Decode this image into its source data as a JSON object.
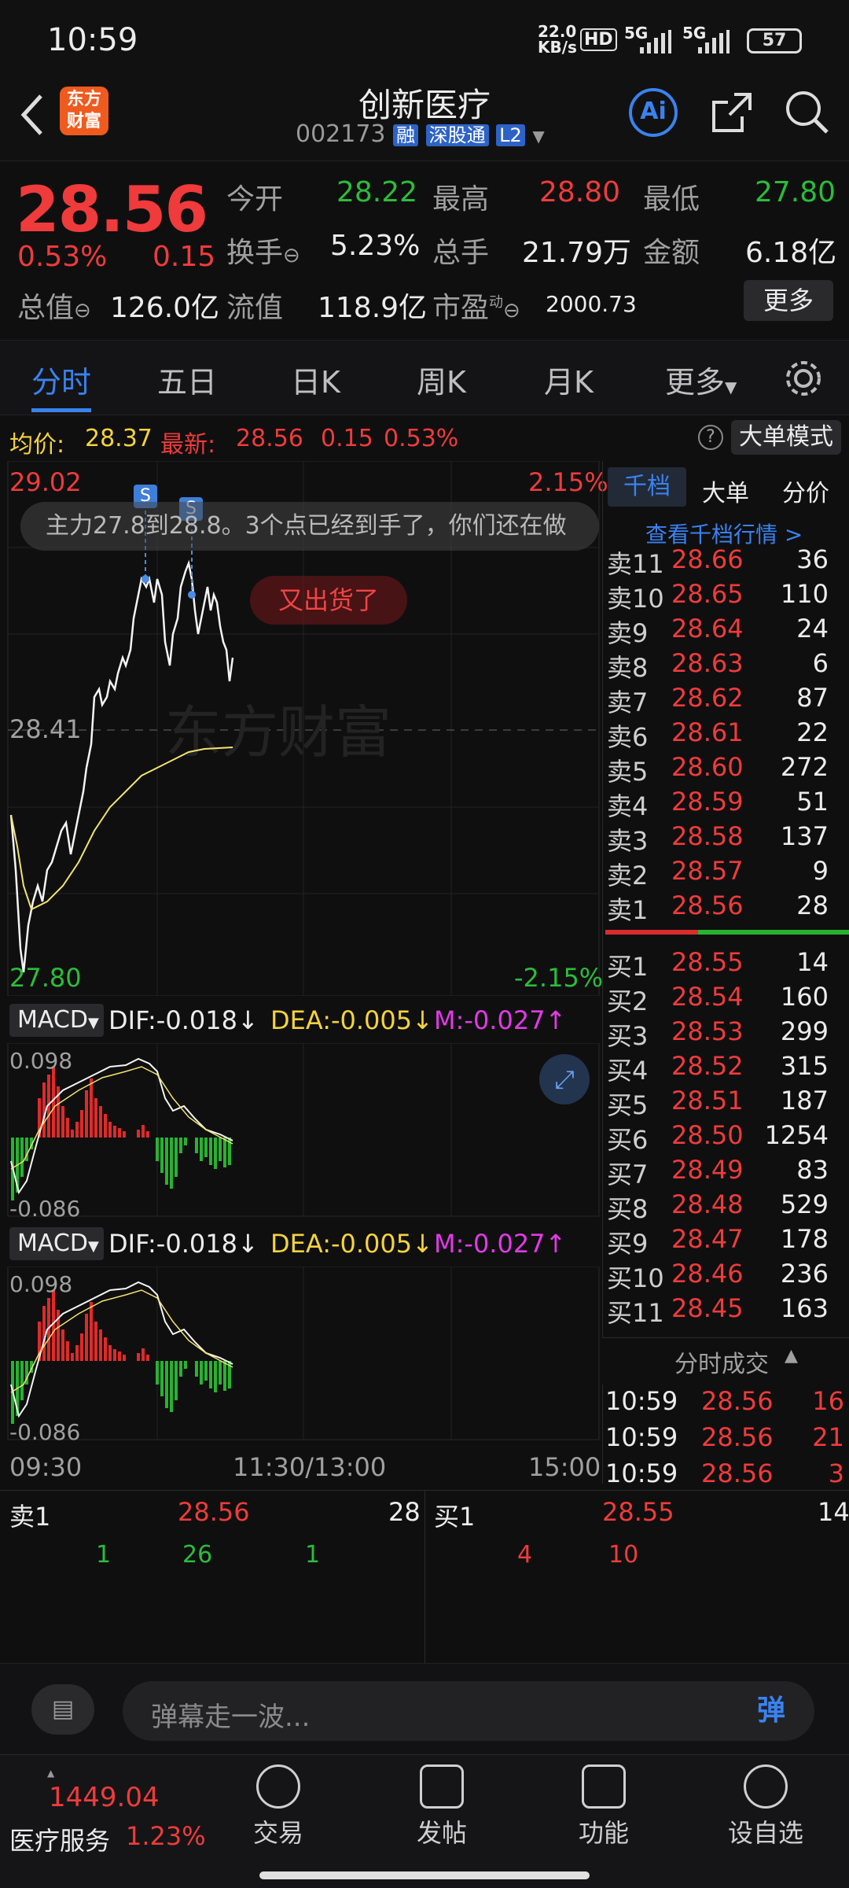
{
  "status": {
    "time": "10:59",
    "speed": "22.0",
    "speed_unit": "KB/s",
    "hd": "HD",
    "net1": "5G",
    "net2": "5G",
    "battery": "57"
  },
  "title": {
    "app_logo": "东方财富",
    "name": "创新医疗",
    "code": "002173",
    "tags": [
      "融",
      "深股通",
      "L2"
    ]
  },
  "quote": {
    "price": "28.56",
    "pct": "0.53%",
    "chg": "0.15",
    "open_lbl": "今开",
    "open": "28.22",
    "high_lbl": "最高",
    "high": "28.80",
    "low_lbl": "最低",
    "low": "27.80",
    "turn_lbl": "换手",
    "turn": "5.23%",
    "vol_lbl": "总手",
    "vol": "21.79万",
    "amt_lbl": "金额",
    "amt": "6.18亿",
    "mcap_lbl": "总值",
    "mcap": "126.0亿",
    "float_lbl": "流值",
    "float": "118.9亿",
    "pe_lbl": "市盈",
    "pe_sup": "动",
    "pe": "2000.73",
    "more": "更多"
  },
  "tabs": [
    "分时",
    "五日",
    "日K",
    "周K",
    "月K",
    "更多"
  ],
  "chart_header": {
    "avg_lbl": "均价:",
    "avg": "28.37",
    "last_lbl": "最新:",
    "last": "28.56",
    "chg": "0.15",
    "pct": "0.53%",
    "mode": "大单模式"
  },
  "chart": {
    "top_price": "29.02",
    "top_pct": "2.15%",
    "mid_price": "28.41",
    "bot_price": "27.80",
    "bot_pct": "-2.15%",
    "danmu": "主力27.8到28.8。3个点已经到手了，你们还在做",
    "bubble": "又出货了",
    "watermark": "东方财富",
    "s_mark": "S"
  },
  "macd1": {
    "name": "MACD",
    "dif": "DIF:-0.018",
    "dea": "DEA:-0.005",
    "m": "M:-0.027",
    "top": "0.098",
    "bot": "-0.086"
  },
  "macd2": {
    "name": "MACD",
    "dif": "DIF:-0.018",
    "dea": "DEA:-0.005",
    "m": "M:-0.027",
    "top": "0.098",
    "bot": "-0.086"
  },
  "xaxis": {
    "start": "09:30",
    "mid": "11:30/13:00",
    "end": "15:00"
  },
  "orderbook": {
    "tab1": "千档",
    "tab2": "大单",
    "tab3": "分价",
    "link": "查看千档行情 >",
    "asks": [
      {
        "l": "卖11",
        "p": "28.66",
        "v": "36"
      },
      {
        "l": "卖10",
        "p": "28.65",
        "v": "110"
      },
      {
        "l": "卖9",
        "p": "28.64",
        "v": "24"
      },
      {
        "l": "卖8",
        "p": "28.63",
        "v": "6"
      },
      {
        "l": "卖7",
        "p": "28.62",
        "v": "87"
      },
      {
        "l": "卖6",
        "p": "28.61",
        "v": "22"
      },
      {
        "l": "卖5",
        "p": "28.60",
        "v": "272"
      },
      {
        "l": "卖4",
        "p": "28.59",
        "v": "51"
      },
      {
        "l": "卖3",
        "p": "28.58",
        "v": "137"
      },
      {
        "l": "卖2",
        "p": "28.57",
        "v": "9"
      },
      {
        "l": "卖1",
        "p": "28.56",
        "v": "28"
      }
    ],
    "bids": [
      {
        "l": "买1",
        "p": "28.55",
        "v": "14"
      },
      {
        "l": "买2",
        "p": "28.54",
        "v": "160"
      },
      {
        "l": "买3",
        "p": "28.53",
        "v": "299"
      },
      {
        "l": "买4",
        "p": "28.52",
        "v": "315"
      },
      {
        "l": "买5",
        "p": "28.51",
        "v": "187"
      },
      {
        "l": "买6",
        "p": "28.50",
        "v": "1254"
      },
      {
        "l": "买7",
        "p": "28.49",
        "v": "83"
      },
      {
        "l": "买8",
        "p": "28.48",
        "v": "529"
      },
      {
        "l": "买9",
        "p": "28.47",
        "v": "178"
      },
      {
        "l": "买10",
        "p": "28.46",
        "v": "236"
      },
      {
        "l": "买11",
        "p": "28.45",
        "v": "163"
      }
    ],
    "trades_lbl": "分时成交",
    "trades": [
      {
        "t": "10:59",
        "p": "28.56",
        "v": "16"
      },
      {
        "t": "10:59",
        "p": "28.56",
        "v": "21"
      },
      {
        "t": "10:59",
        "p": "28.56",
        "v": "3"
      }
    ]
  },
  "queue": {
    "sell_lbl": "卖1",
    "sell_px": "28.56",
    "sell_vol": "28",
    "buy_lbl": "买1",
    "buy_px": "28.55",
    "buy_vol": "14",
    "sell_q": [
      "1",
      "26",
      "1"
    ],
    "buy_q": [
      "4",
      "10"
    ]
  },
  "comment": {
    "placeholder": "弹幕走一波...",
    "btn": "弹"
  },
  "nav": {
    "index_val": "1449.04",
    "index_name": "医疗服务",
    "index_pct": "1.23%",
    "items": [
      "交易",
      "发帖",
      "功能",
      "设自选"
    ]
  }
}
